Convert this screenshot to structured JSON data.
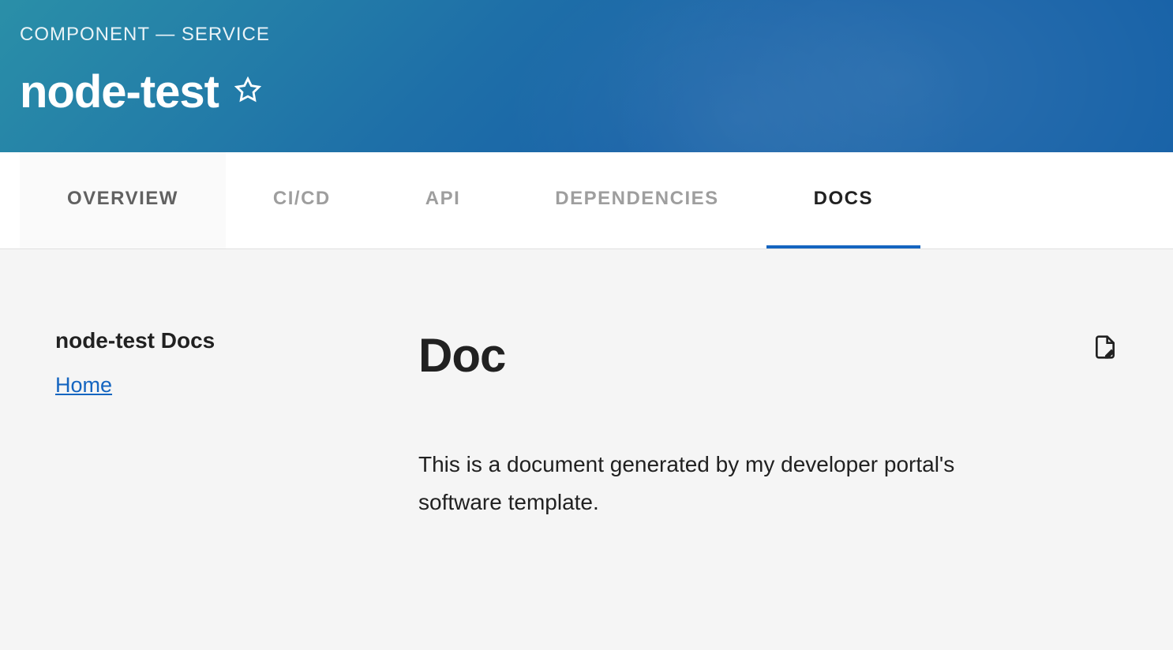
{
  "header": {
    "breadcrumb": "COMPONENT — SERVICE",
    "title": "node-test"
  },
  "tabs": [
    {
      "label": "OVERVIEW",
      "active": false
    },
    {
      "label": "CI/CD",
      "active": false
    },
    {
      "label": "API",
      "active": false
    },
    {
      "label": "DEPENDENCIES",
      "active": false
    },
    {
      "label": "DOCS",
      "active": true
    }
  ],
  "sidebar": {
    "title": "node-test Docs",
    "links": [
      {
        "label": "Home"
      }
    ]
  },
  "doc": {
    "title": "Doc",
    "body": "This is a document generated by my developer portal's software template."
  }
}
